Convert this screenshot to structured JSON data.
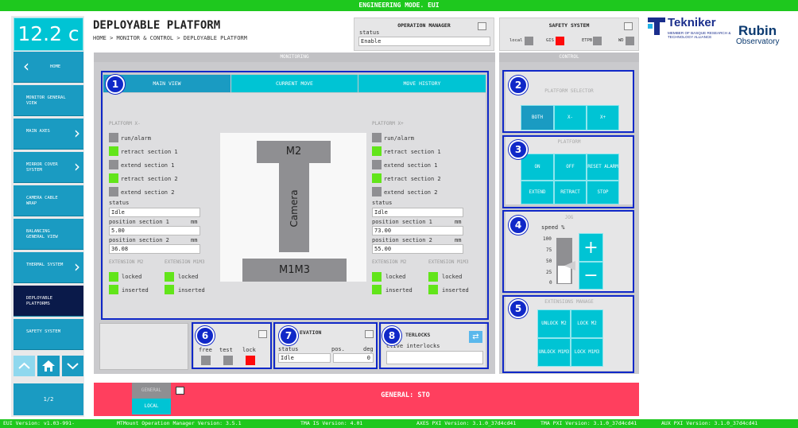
{
  "topbar": {
    "title": "ENGINEERING MODE. EUI"
  },
  "temperature": "12.2 c",
  "nav": {
    "items": [
      {
        "label": "HOME"
      },
      {
        "label": "MONITOR GENERAL VIEW"
      },
      {
        "label": "MAIN AXES"
      },
      {
        "label": "MIRROR COVER SYSTEM"
      },
      {
        "label": "CAMERA CABLE WRAP"
      },
      {
        "label": "BALANCING GENERAL VIEW"
      },
      {
        "label": "THERMAL SYSTEM"
      },
      {
        "label": "DEPLOYABLE PLATFORMS"
      },
      {
        "label": "SAFETY SYSTEM"
      }
    ],
    "page": "1/2"
  },
  "header": {
    "title": "DEPLOYABLE PLATFORM",
    "breadcrumb": "HOME > MONITOR & CONTROL > DEPLOYABLE PLATFORM"
  },
  "opmanager": {
    "title": "OPERATION MANAGER",
    "status_label": "status",
    "status_value": "Enable"
  },
  "safety": {
    "title": "SAFETY SYSTEM",
    "local": "local",
    "gis": "GIS",
    "etpb": "ETPB",
    "wd": "WD"
  },
  "logo": {
    "tekniker": "Tekniker",
    "tekniker_sub": "MEMBER OF BASQUE RESEARCH & TECHNOLOGY ALLIANCE",
    "rubin1": "Rubin",
    "rubin2": "Observatory"
  },
  "monitoring": {
    "title": "MONITORING",
    "tabs": [
      "MAIN VIEW",
      "CURRENT MOVE",
      "MOVE HISTORY"
    ],
    "left": {
      "title": "PLATFORM X-",
      "indicators": [
        "run/alarm",
        "retract section 1",
        "extend section 1",
        "retract section 2",
        "extend section 2"
      ],
      "status_label": "status",
      "status_value": "Idle",
      "pos1_label": "position section 1",
      "pos1_unit": "mm",
      "pos1_value": "5.00",
      "pos2_label": "position section 2",
      "pos2_unit": "mm",
      "pos2_value": "36.08",
      "ext_m2": "EXTENSION M2",
      "ext_m1m3": "EXTENSION M1M3",
      "locked": "locked",
      "inserted": "inserted"
    },
    "right": {
      "title": "PLATFORM X+",
      "indicators": [
        "run/alarm",
        "retract section 1",
        "extend section 1",
        "retract section 2",
        "extend section 2"
      ],
      "status_label": "status",
      "status_value": "Idle",
      "pos1_label": "position section 1",
      "pos1_unit": "mm",
      "pos1_value": "73.00",
      "pos2_label": "position section 2",
      "pos2_unit": "mm",
      "pos2_value": "55.00",
      "ext_m2": "EXTENSION M2",
      "ext_m1m3": "EXTENSION M1M3",
      "locked": "locked",
      "inserted": "inserted"
    },
    "diagram": {
      "m2": "M2",
      "camera": "Camera",
      "m1m3": "M1M3"
    }
  },
  "locking": {
    "title": "G",
    "free": "free",
    "test": "test",
    "lock": "lock"
  },
  "elevation": {
    "title": "EVATION",
    "status_label": "status",
    "pos_label": "pos.",
    "deg_label": "deg",
    "status_value": "Idle",
    "pos_value": "0"
  },
  "interlocks": {
    "title": "TERLOCKS",
    "active_label": "ctive interlocks"
  },
  "control": {
    "title": "CONTROL",
    "selector_title": "PLATFORM SELECTOR",
    "selector": [
      "BOTH",
      "X-",
      "X+"
    ],
    "platform_title": "PLATFORM",
    "platform_btns": [
      "ON",
      "OFF",
      "RESET ALARM",
      "EXTEND",
      "RETRACT",
      "STOP"
    ],
    "jog_title": "JOG",
    "speed_label": "speed %",
    "speed_ticks": [
      "100",
      "75",
      "50",
      "25",
      "0"
    ],
    "speed_value": 40,
    "plus": "+",
    "minus": "−",
    "ext_title": "EXTENSIONS MANAGE",
    "ext_btns": [
      "UNLOCK M2",
      "LOCK M2",
      "UNLOCK M1M3",
      "LOCK M1M3"
    ]
  },
  "footer": {
    "general": "GENERAL",
    "local": "LOCAL",
    "sto": "GENERAL: STO"
  },
  "badges": [
    "1",
    "2",
    "3",
    "4",
    "5",
    "6",
    "7",
    "8"
  ],
  "versions": {
    "eui": "EUI Version: v1.03-991-",
    "mtmount": "MTMount Operation Manager Version: 3.5.1",
    "tma_is": "TMA IS Version: 4.01",
    "axes": "AXES PXI Version: 3.1.0_37d4cd41",
    "tma_pxi": "TMA PXI Version: 3.1.0_37d4cd41",
    "aux": "AUX PXI Version: 3.1.0_37d4cd41"
  },
  "colors": {
    "green": "#62e51a",
    "red": "#ff0a0a",
    "cyan": "#00c4d4",
    "blue": "#1a9bc2",
    "sto": "#ff3f5e"
  }
}
